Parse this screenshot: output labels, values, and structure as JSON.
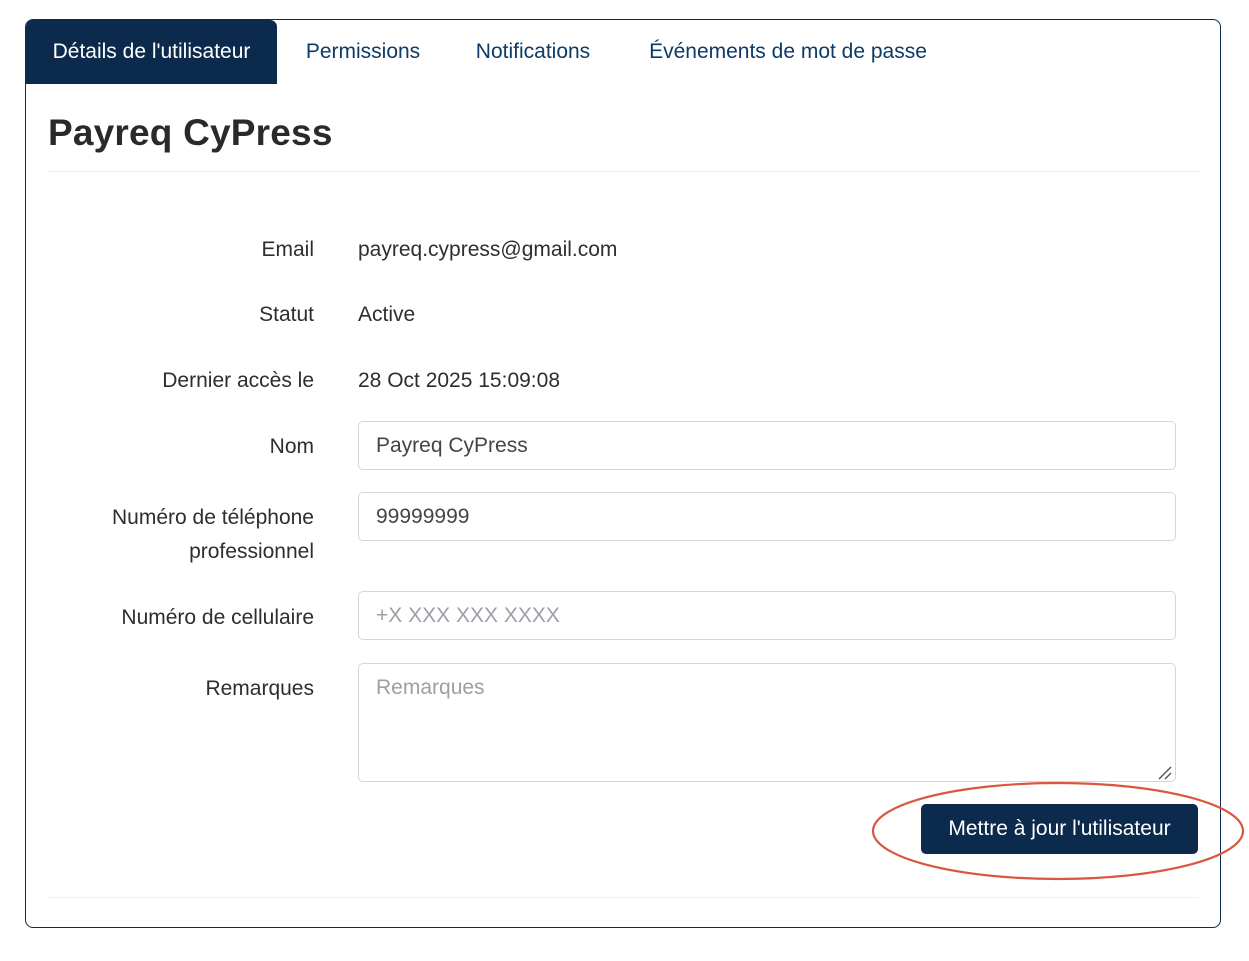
{
  "tabs": [
    {
      "label": "Détails de l'utilisateur",
      "active": true
    },
    {
      "label": "Permissions",
      "active": false
    },
    {
      "label": "Notifications",
      "active": false
    },
    {
      "label": "Événements de mot de passe",
      "active": false
    }
  ],
  "user": {
    "title": "Payreq CyPress"
  },
  "details": {
    "email_label": "Email",
    "email_value": "payreq.cypress@gmail.com",
    "status_label": "Statut",
    "status_value": "Active",
    "last_access_label": "Dernier accès le",
    "last_access_value": "28 Oct 2025 15:09:08"
  },
  "form": {
    "name_label": "Nom",
    "name_value": "Payreq CyPress",
    "work_phone_label_line1": "Numéro de téléphone",
    "work_phone_label_line2": "professionnel",
    "work_phone_value": "99999999",
    "mobile_label": "Numéro de cellulaire",
    "mobile_placeholder": "+X XXX XXX XXXX",
    "remarks_label": "Remarques",
    "remarks_placeholder": "Remarques",
    "submit_label": "Mettre à jour l'utilisateur"
  },
  "colors": {
    "primary": "#0b2a4c",
    "tab_text": "#0d3b66",
    "annotation": "#d9573f"
  }
}
